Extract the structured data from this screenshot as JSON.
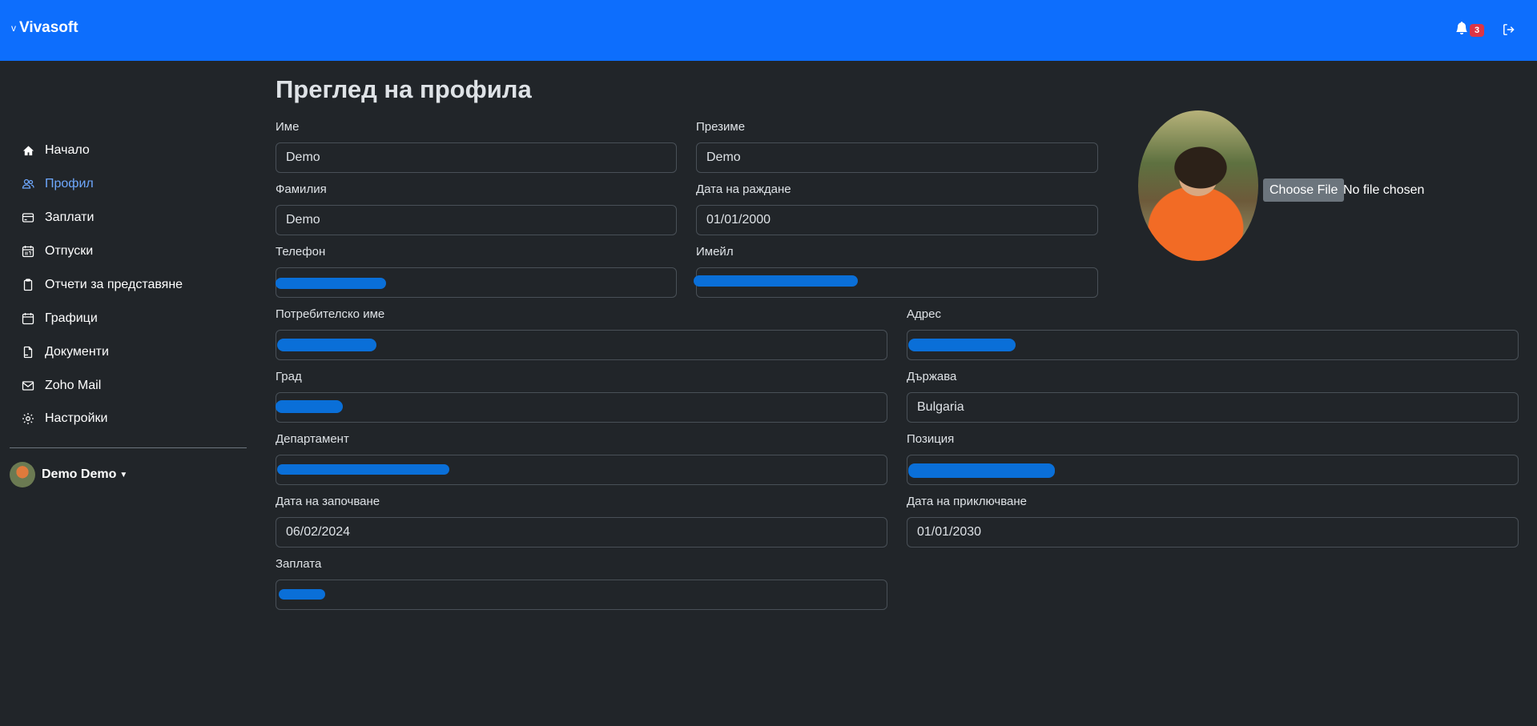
{
  "header": {
    "brand_mark": "v",
    "brand": "Vivasoft",
    "notification_count": "3",
    "bar_color": "#0d6efd"
  },
  "sidebar": {
    "items": [
      {
        "label": "Начало",
        "icon": "home-icon"
      },
      {
        "label": "Профил",
        "icon": "users-icon",
        "active": true
      },
      {
        "label": "Заплати",
        "icon": "credit-card-icon"
      },
      {
        "label": "Отпуски",
        "icon": "calendar-icon"
      },
      {
        "label": "Отчети за представяне",
        "icon": "clipboard-icon"
      },
      {
        "label": "Графици",
        "icon": "calendar-blank-icon"
      },
      {
        "label": "Документи",
        "icon": "document-icon"
      },
      {
        "label": "Zoho Mail",
        "icon": "mail-icon"
      },
      {
        "label": "Настройки",
        "icon": "gear-icon"
      }
    ],
    "user_name": "Demo Demo"
  },
  "main": {
    "title": "Преглед на профила",
    "fields": {
      "first_name": {
        "label": "Име",
        "value": "Demo"
      },
      "middle_name": {
        "label": "Презиме",
        "value": "Demo"
      },
      "last_name": {
        "label": "Фамилия",
        "value": "Demo"
      },
      "birth_date": {
        "label": "Дата на раждане",
        "value": "01/01/2000"
      },
      "phone": {
        "label": "Телефон",
        "value": ""
      },
      "email": {
        "label": "Имейл",
        "value": ""
      },
      "username": {
        "label": "Потребителско име",
        "value": ""
      },
      "address": {
        "label": "Адрес",
        "value": ""
      },
      "city": {
        "label": "Град",
        "value": ""
      },
      "country": {
        "label": "Държава",
        "value": "Bulgaria"
      },
      "department": {
        "label": "Департамент",
        "value": ""
      },
      "position": {
        "label": "Позиция",
        "value": ""
      },
      "start_date": {
        "label": "Дата на започване",
        "value": "06/02/2024"
      },
      "end_date": {
        "label": "Дата на приключване",
        "value": "01/01/2030"
      },
      "salary": {
        "label": "Заплата",
        "value": ""
      }
    },
    "file_input": {
      "button_label": "Choose File",
      "status_text": "No file chosen"
    }
  },
  "colors": {
    "background": "#212529",
    "accent": "#0d6efd",
    "active_link": "#6ea8fe",
    "badge": "#dc3545",
    "redaction": "#0a6fd8"
  }
}
